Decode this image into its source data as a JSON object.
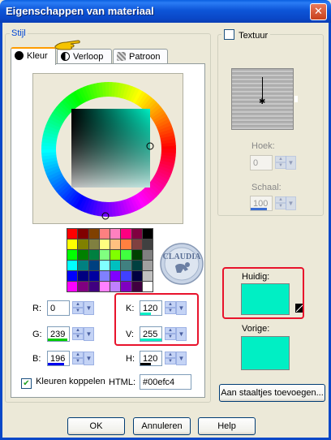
{
  "window": {
    "title": "Eigenschappen van materiaal",
    "close_glyph": "✕"
  },
  "stijl": {
    "label": "Stijl",
    "tabs": [
      {
        "label": "Kleur",
        "icon": "filled-circle-icon"
      },
      {
        "label": "Verloop",
        "icon": "half-circle-icon"
      },
      {
        "label": "Patroon",
        "icon": "pattern-icon"
      }
    ]
  },
  "swatch_colors": [
    "#ff0000",
    "#800000",
    "#804000",
    "#ff8080",
    "#ff80c0",
    "#ff0080",
    "#800040",
    "#000000",
    "#ffff00",
    "#808000",
    "#808040",
    "#ffff80",
    "#ffc080",
    "#ff8040",
    "#804040",
    "#404040",
    "#00ff00",
    "#008000",
    "#008040",
    "#80ff80",
    "#80ff00",
    "#40ff40",
    "#004000",
    "#808080",
    "#00ffff",
    "#008080",
    "#004080",
    "#80ffff",
    "#00c0c0",
    "#408080",
    "#004040",
    "#a0a0a0",
    "#0000ff",
    "#000080",
    "#0000a0",
    "#8080ff",
    "#8000ff",
    "#4040ff",
    "#000040",
    "#c0c0c0",
    "#ff00ff",
    "#800080",
    "#400080",
    "#ff80ff",
    "#c080ff",
    "#8000c0",
    "#400040",
    "#ffffff"
  ],
  "fields": {
    "r": {
      "label": "R:",
      "value": "0"
    },
    "g": {
      "label": "G:",
      "value": "239"
    },
    "b": {
      "label": "B:",
      "value": "196"
    },
    "k": {
      "label": "K:",
      "value": "120"
    },
    "v": {
      "label": "V:",
      "value": "255"
    },
    "h": {
      "label": "H:",
      "value": "120"
    }
  },
  "levels": {
    "r": 0,
    "g": 0.94,
    "b": 0.77,
    "k": 0.5,
    "v": 1.0,
    "h": 0.5
  },
  "koppelen": {
    "label": "Kleuren koppelen",
    "checked": true
  },
  "html": {
    "label": "HTML:",
    "value": "#00efc4"
  },
  "textuur": {
    "label": "Textuur",
    "hoek": {
      "label": "Hoek:",
      "value": "0"
    },
    "schaal": {
      "label": "Schaal:",
      "value": "100"
    }
  },
  "huidig": {
    "label": "Huidig:",
    "color": "#00efc4"
  },
  "vorige": {
    "label": "Vorige:",
    "color": "#00efc4"
  },
  "add_swatch_button": "Aan staaltjes toevoegen...",
  "buttons": {
    "ok": "OK",
    "cancel": "Annuleren",
    "help": "Help"
  },
  "watermark": "CLAUDIA"
}
